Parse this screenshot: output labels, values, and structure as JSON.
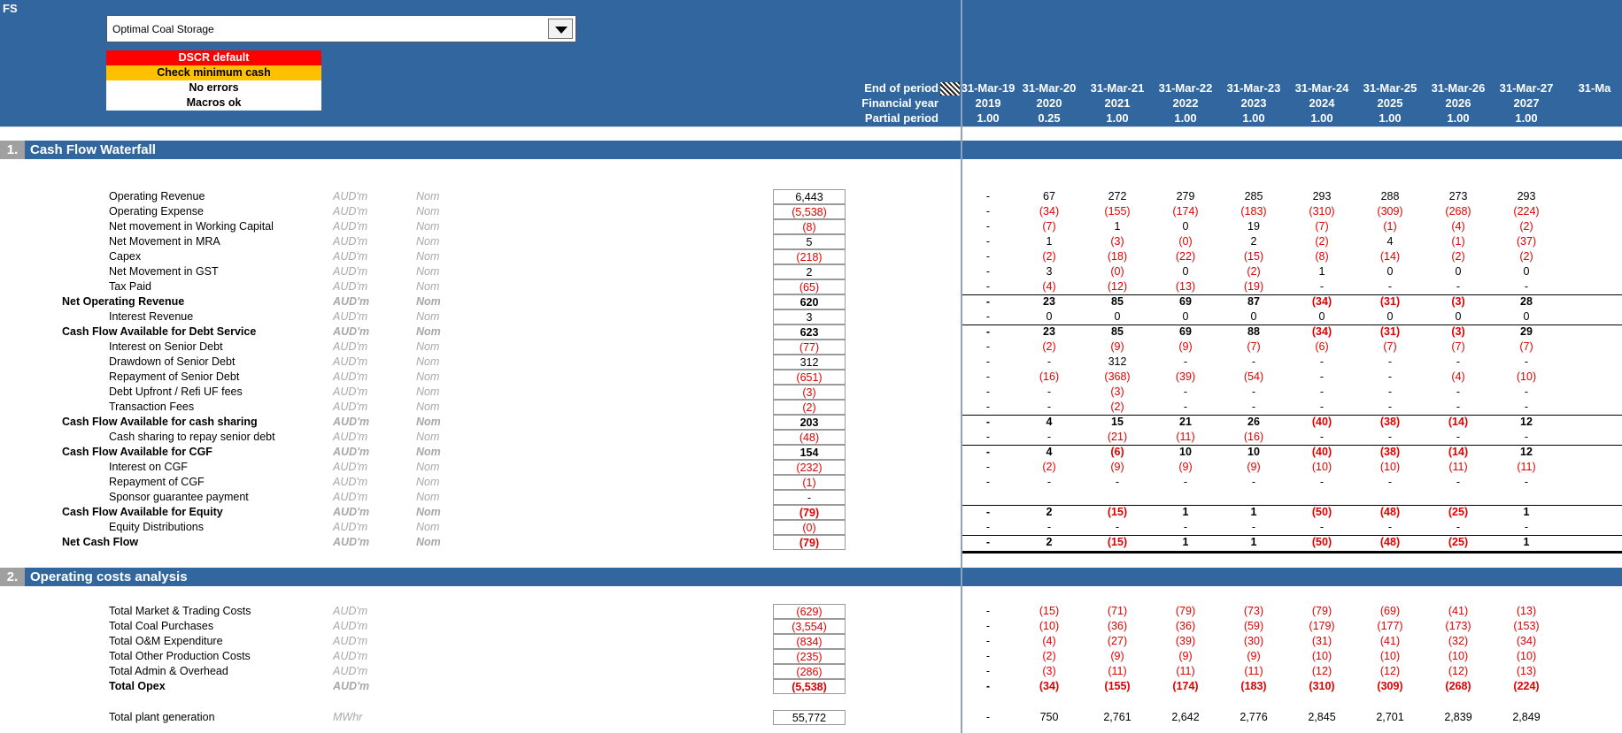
{
  "app": {
    "sheet_label": "FS"
  },
  "scenario": {
    "selected": "Optimal Coal Storage"
  },
  "checks": [
    {
      "label": "DSCR default",
      "bg": "#ff0000",
      "fg": "#ffffff"
    },
    {
      "label": "Check minimum cash",
      "bg": "#ffc000",
      "fg": "#000000"
    },
    {
      "label": "No errors",
      "bg": "#ffffff",
      "fg": "#000000"
    },
    {
      "label": "Macros ok",
      "bg": "#ffffff",
      "fg": "#000000"
    }
  ],
  "header_labels": {
    "end_of_period": "End of period",
    "financial_year": "Financial year",
    "partial_period": "Partial period"
  },
  "periods": [
    {
      "end": "31-Mar-19",
      "fy": "2019",
      "partial": "1.00"
    },
    {
      "end": "31-Mar-20",
      "fy": "2020",
      "partial": "0.25"
    },
    {
      "end": "31-Mar-21",
      "fy": "2021",
      "partial": "1.00"
    },
    {
      "end": "31-Mar-22",
      "fy": "2022",
      "partial": "1.00"
    },
    {
      "end": "31-Mar-23",
      "fy": "2023",
      "partial": "1.00"
    },
    {
      "end": "31-Mar-24",
      "fy": "2024",
      "partial": "1.00"
    },
    {
      "end": "31-Mar-25",
      "fy": "2025",
      "partial": "1.00"
    },
    {
      "end": "31-Mar-26",
      "fy": "2026",
      "partial": "1.00"
    },
    {
      "end": "31-Mar-27",
      "fy": "2027",
      "partial": "1.00"
    },
    {
      "end": "31-Ma",
      "fy": "",
      "partial": ""
    }
  ],
  "sections": [
    {
      "num": "1.",
      "title": "Cash Flow Waterfall"
    },
    {
      "num": "2.",
      "title": "Operating costs analysis"
    }
  ],
  "colors": {
    "header_blue": "#31669e",
    "negative_red": "#e00000",
    "unit_grey": "#a8a8a8"
  },
  "cash_flow_rows": [
    {
      "label": "Operating Revenue",
      "unit": "AUD'm",
      "type": "Nom",
      "total": "6,443",
      "values": [
        "-",
        "67",
        "272",
        "279",
        "285",
        "293",
        "288",
        "273",
        "293"
      ]
    },
    {
      "label": "Operating Expense",
      "unit": "AUD'm",
      "type": "Nom",
      "total": "(5,538)",
      "values": [
        "-",
        "(34)",
        "(155)",
        "(174)",
        "(183)",
        "(310)",
        "(309)",
        "(268)",
        "(224)"
      ]
    },
    {
      "label": "Net movement in Working Capital",
      "unit": "AUD'm",
      "type": "Nom",
      "total": "(8)",
      "values": [
        "-",
        "(7)",
        "1",
        "0",
        "19",
        "(7)",
        "(1)",
        "(4)",
        "(2)"
      ]
    },
    {
      "label": "Net Movement in MRA",
      "unit": "AUD'm",
      "type": "Nom",
      "total": "5",
      "values": [
        "-",
        "1",
        "(3)",
        "(0)",
        "2",
        "(2)",
        "4",
        "(1)",
        "(37)"
      ]
    },
    {
      "label": "Capex",
      "unit": "AUD'm",
      "type": "Nom",
      "total": "(218)",
      "values": [
        "-",
        "(2)",
        "(18)",
        "(22)",
        "(15)",
        "(8)",
        "(14)",
        "(2)",
        "(2)"
      ]
    },
    {
      "label": "Net Movement in GST",
      "unit": "AUD'm",
      "type": "Nom",
      "total": "2",
      "values": [
        "-",
        "3",
        "(0)",
        "0",
        "(2)",
        "1",
        "0",
        "0",
        "0"
      ]
    },
    {
      "label": "Tax Paid",
      "unit": "AUD'm",
      "type": "Nom",
      "total": "(65)",
      "values": [
        "-",
        "(4)",
        "(12)",
        "(13)",
        "(19)",
        "-",
        "-",
        "-",
        "-"
      ]
    },
    {
      "label": "Net Operating Revenue",
      "unit": "AUD'm",
      "type": "Nom",
      "total": "620",
      "bold": true,
      "line": "top",
      "values": [
        "-",
        "23",
        "85",
        "69",
        "87",
        "(34)",
        "(31)",
        "(3)",
        "28"
      ]
    },
    {
      "label": "Interest Revenue",
      "unit": "AUD'm",
      "type": "Nom",
      "total": "3",
      "values": [
        "-",
        "0",
        "0",
        "0",
        "0",
        "0",
        "0",
        "0",
        "0"
      ]
    },
    {
      "label": "Cash Flow Available for Debt Service",
      "unit": "AUD'm",
      "type": "Nom",
      "total": "623",
      "bold": true,
      "line": "top",
      "values": [
        "-",
        "23",
        "85",
        "69",
        "88",
        "(34)",
        "(31)",
        "(3)",
        "29"
      ]
    },
    {
      "label": "Interest on Senior Debt",
      "unit": "AUD'm",
      "type": "Nom",
      "total": "(77)",
      "values": [
        "-",
        "(2)",
        "(9)",
        "(9)",
        "(7)",
        "(6)",
        "(7)",
        "(7)",
        "(7)"
      ]
    },
    {
      "label": "Drawdown of Senior Debt",
      "unit": "AUD'm",
      "type": "Nom",
      "total": "312",
      "values": [
        "-",
        "-",
        "312",
        "-",
        "-",
        "-",
        "-",
        "-",
        "-"
      ]
    },
    {
      "label": "Repayment of Senior Debt",
      "unit": "AUD'm",
      "type": "Nom",
      "total": "(651)",
      "values": [
        "-",
        "(16)",
        "(368)",
        "(39)",
        "(54)",
        "-",
        "-",
        "(4)",
        "(10)"
      ]
    },
    {
      "label": "Debt Upfront / Refi UF fees",
      "unit": "AUD'm",
      "type": "Nom",
      "total": "(3)",
      "values": [
        "-",
        "-",
        "(3)",
        "-",
        "-",
        "-",
        "-",
        "-",
        "-"
      ]
    },
    {
      "label": "Transaction Fees",
      "unit": "AUD'm",
      "type": "Nom",
      "total": "(2)",
      "values": [
        "-",
        "-",
        "(2)",
        "-",
        "-",
        "-",
        "-",
        "-",
        "-"
      ]
    },
    {
      "label": "Cash Flow Available for cash sharing",
      "unit": "AUD'm",
      "type": "Nom",
      "total": "203",
      "bold": true,
      "line": "top",
      "values": [
        "-",
        "4",
        "15",
        "21",
        "26",
        "(40)",
        "(38)",
        "(14)",
        "12"
      ]
    },
    {
      "label": "Cash sharing to repay senior debt",
      "unit": "AUD'm",
      "type": "Nom",
      "total": "(48)",
      "values": [
        "-",
        "-",
        "(21)",
        "(11)",
        "(16)",
        "-",
        "-",
        "-",
        "-"
      ]
    },
    {
      "label": "Cash Flow Available for CGF",
      "unit": "AUD'm",
      "type": "Nom",
      "total": "154",
      "bold": true,
      "line": "top",
      "values": [
        "-",
        "4",
        "(6)",
        "10",
        "10",
        "(40)",
        "(38)",
        "(14)",
        "12"
      ]
    },
    {
      "label": "Interest on CGF",
      "unit": "AUD'm",
      "type": "Nom",
      "total": "(232)",
      "values": [
        "-",
        "(2)",
        "(9)",
        "(9)",
        "(9)",
        "(10)",
        "(10)",
        "(11)",
        "(11)"
      ]
    },
    {
      "label": "Repayment of CGF",
      "unit": "AUD'm",
      "type": "Nom",
      "total": "(1)",
      "values": [
        "-",
        "-",
        "-",
        "-",
        "-",
        "-",
        "-",
        "-",
        "-"
      ]
    },
    {
      "label": "Sponsor guarantee payment",
      "unit": "AUD'm",
      "type": "Nom",
      "total": "-",
      "values": [
        "",
        "",
        "",
        "",
        "",
        "",
        "",
        "",
        ""
      ]
    },
    {
      "label": "Cash Flow Available for Equity",
      "unit": "AUD'm",
      "type": "Nom",
      "total": "(79)",
      "bold": true,
      "line": "top",
      "values": [
        "-",
        "2",
        "(15)",
        "1",
        "1",
        "(50)",
        "(48)",
        "(25)",
        "1"
      ]
    },
    {
      "label": "Equity Distributions",
      "unit": "AUD'm",
      "type": "Nom",
      "total": "(0)",
      "values": [
        "-",
        "-",
        "-",
        "-",
        "-",
        "-",
        "-",
        "-",
        "-"
      ]
    },
    {
      "label": "Net Cash Flow",
      "unit": "AUD'm",
      "type": "Nom",
      "total": "(79)",
      "bold": true,
      "line": "double",
      "values": [
        "-",
        "2",
        "(15)",
        "1",
        "1",
        "(50)",
        "(48)",
        "(25)",
        "1"
      ]
    }
  ],
  "opex_rows": [
    {
      "label": "Total Market & Trading Costs",
      "unit": "AUD'm",
      "type": "",
      "total": "(629)",
      "values": [
        "-",
        "(15)",
        "(71)",
        "(79)",
        "(73)",
        "(79)",
        "(69)",
        "(41)",
        "(13)"
      ]
    },
    {
      "label": "Total Coal Purchases",
      "unit": "AUD'm",
      "type": "",
      "total": "(3,554)",
      "values": [
        "-",
        "(10)",
        "(36)",
        "(36)",
        "(59)",
        "(179)",
        "(177)",
        "(173)",
        "(153)"
      ]
    },
    {
      "label": "Total O&M Expenditure",
      "unit": "AUD'm",
      "type": "",
      "total": "(834)",
      "values": [
        "-",
        "(4)",
        "(27)",
        "(39)",
        "(30)",
        "(31)",
        "(41)",
        "(32)",
        "(34)"
      ]
    },
    {
      "label": "Total Other Production Costs",
      "unit": "AUD'm",
      "type": "",
      "total": "(235)",
      "values": [
        "-",
        "(2)",
        "(9)",
        "(9)",
        "(9)",
        "(10)",
        "(10)",
        "(10)",
        "(10)"
      ]
    },
    {
      "label": "Total Admin & Overhead",
      "unit": "AUD'm",
      "type": "",
      "total": "(286)",
      "values": [
        "-",
        "(3)",
        "(11)",
        "(11)",
        "(11)",
        "(12)",
        "(12)",
        "(12)",
        "(13)"
      ]
    },
    {
      "label": "Total Opex",
      "unit": "AUD'm",
      "type": "",
      "total": "(5,538)",
      "bold": true,
      "indentBold": true,
      "values": [
        "-",
        "(34)",
        "(155)",
        "(174)",
        "(183)",
        "(310)",
        "(309)",
        "(268)",
        "(224)"
      ]
    }
  ],
  "generation_row": {
    "label": "Total plant generation",
    "unit": "MWhr",
    "type": "",
    "total": "55,772",
    "values": [
      "-",
      "750",
      "2,761",
      "2,642",
      "2,776",
      "2,845",
      "2,701",
      "2,839",
      "2,849"
    ]
  }
}
